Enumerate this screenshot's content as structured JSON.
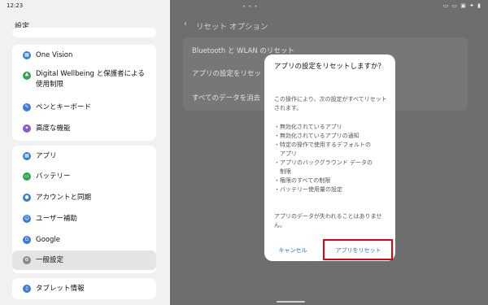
{
  "status": {
    "time": "12:23",
    "icons": "▭ ▭ ▣ ✦ ▮"
  },
  "left": {
    "title": "設定",
    "group1": [
      {
        "label": "One Vision",
        "icon": "grid-icon",
        "color": "#3a7bd5"
      },
      {
        "label": "Digital Wellbeing と保護者による",
        "label2": "使用制限",
        "icon": "leaf-icon",
        "color": "#2ea44f"
      },
      {
        "label": "ペンとキーボード",
        "icon": "pen-icon",
        "color": "#3a7bd5"
      },
      {
        "label": "高度な機能",
        "icon": "star-icon",
        "color": "#8a5cd0"
      }
    ],
    "group2": [
      {
        "label": "アプリ",
        "icon": "apps-icon",
        "color": "#3a7bd5"
      },
      {
        "label": "バッテリー",
        "icon": "battery-icon",
        "color": "#2ea44f"
      },
      {
        "label": "アカウントと同期",
        "icon": "account-icon",
        "color": "#3a7bd5"
      },
      {
        "label": "ユーザー補助",
        "icon": "accessibility-icon",
        "color": "#3a7bd5"
      },
      {
        "label": "Google",
        "icon": "google-icon",
        "color": "#3a7bd5"
      },
      {
        "label": "一般設定",
        "icon": "gear-icon",
        "color": "#8a8a8a"
      }
    ],
    "group3": [
      {
        "label": "タブレット情報",
        "icon": "tablet-icon",
        "color": "#3a7bd5"
      }
    ]
  },
  "right": {
    "header": "リセット オプション",
    "rows": [
      "Bluetooth と WLAN のリセット",
      "アプリの設定をリセッ",
      "すべてのデータを消去"
    ]
  },
  "dialog": {
    "title": "アプリの設定をリセットしますか？",
    "intro": "この操作により、次の設定がすべてリセットされます。",
    "bullets": [
      "・無効化されているアプリ",
      "・無効化されているアプリの通知",
      "・特定の操作で使用するデフォルトの",
      "　アプリ",
      "・アプリのバックグラウンド データの",
      "　制限",
      "・権限のすべての制限",
      "・バッテリー使用量の設定"
    ],
    "note": "アプリのデータが失われることはありません。",
    "cancel": "キャンセル",
    "confirm": "アプリをリセット"
  }
}
